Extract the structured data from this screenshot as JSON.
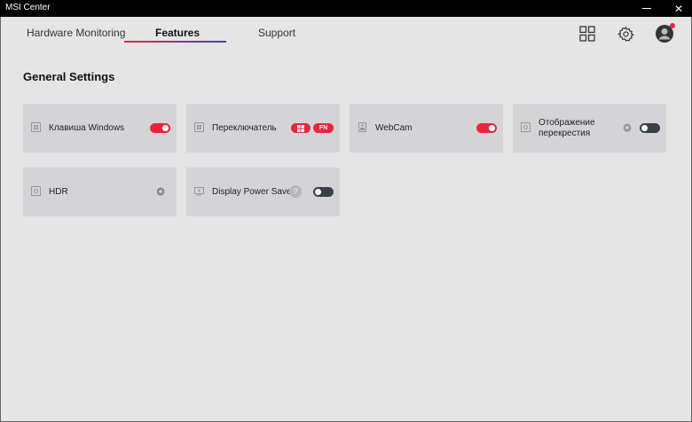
{
  "window": {
    "title": "MSI Center",
    "minimize_label": "",
    "close_label": "✕"
  },
  "tabs": [
    {
      "label": "Hardware Monitoring"
    },
    {
      "label": "Features"
    },
    {
      "label": "Support"
    }
  ],
  "active_tab": "Features",
  "header_icons": [
    "grid-icon",
    "gear-icon",
    "avatar"
  ],
  "section": {
    "title": "General Settings"
  },
  "cards": [
    {
      "label": "Клавиша Windows",
      "icon": "windows-key-icon",
      "control": "toggle",
      "state": "on"
    },
    {
      "label": "Переключатель",
      "icon": "windows-key-icon",
      "control": "key-pills",
      "pills": [
        "",
        "FN"
      ]
    },
    {
      "label": "WebCam",
      "icon": "webcam-icon",
      "control": "toggle",
      "state": "on"
    },
    {
      "label": "Отображение перекрестия",
      "icon": "crosshair-icon",
      "control": "gear+toggle",
      "state": "off"
    },
    {
      "label": "HDR",
      "icon": "hdr-icon",
      "control": "gear"
    },
    {
      "label": "Display Power Saver",
      "icon": "display-icon",
      "control": "help+toggle",
      "state": "off",
      "help_label": "?"
    }
  ],
  "colors": {
    "accent": "#e8263b",
    "toggle_off": "#3a3f4a",
    "card_bg": "#d4d4d6",
    "page_bg": "#e5e5e5",
    "titlebar_bg": "#000000"
  }
}
